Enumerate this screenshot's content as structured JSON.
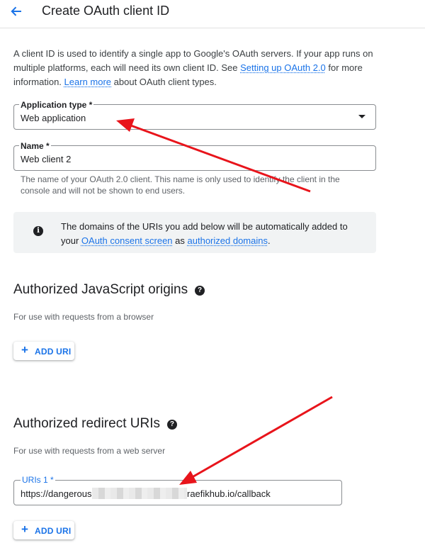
{
  "header": {
    "title": "Create OAuth client ID"
  },
  "intro": {
    "text_before": "A client ID is used to identify a single app to Google's OAuth servers. If your app runs on multiple platforms, each will need its own client ID. See ",
    "link_setup": "Setting up OAuth 2.0",
    "text_middle": " for more information. ",
    "link_learn": "Learn more",
    "text_after": " about OAuth client types."
  },
  "application_type": {
    "label": "Application type *",
    "value": "Web application"
  },
  "name_field": {
    "label": "Name *",
    "value": "Web client 2",
    "helper": "The name of your OAuth 2.0 client. This name is only used to identify the client in the console and will not be shown to end users."
  },
  "info_box": {
    "text_before": "The domains of the URIs you add below will be automatically added to your ",
    "link_consent": "OAuth consent screen",
    "text_middle": " as ",
    "link_domains": "authorized domains",
    "text_after": "."
  },
  "js_origins": {
    "title": "Authorized JavaScript origins",
    "subtitle": "For use with requests from a browser",
    "add_label": "ADD URI"
  },
  "redirect_uris": {
    "title": "Authorized redirect URIs",
    "subtitle": "For use with requests from a web server",
    "uri_label": "URIs 1 *",
    "uri_value_start": "https://dangerous",
    "uri_value_end": "raefikhub.io/callback",
    "add_label": "ADD URI"
  },
  "colors": {
    "accent": "#1a73e8",
    "annotation_arrow": "#e8141b",
    "info_bg": "#f1f3f4"
  },
  "icons": {
    "back": "arrow-back-icon",
    "dropdown": "dropdown-arrow-icon",
    "info": "info-icon",
    "help": "help-icon",
    "add": "plus-icon"
  }
}
